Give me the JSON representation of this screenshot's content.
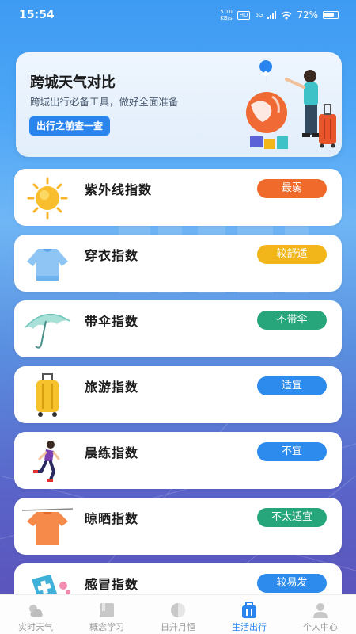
{
  "status": {
    "time": "15:54",
    "speed_value": "5.10",
    "speed_unit": "KB/s",
    "hd": "HD",
    "network": "5G",
    "battery": "72%"
  },
  "banner": {
    "title": "跨城天气对比",
    "subtitle": "跨城出行必备工具，做好全面准备",
    "button": "出行之前查一查"
  },
  "indices": [
    {
      "label": "紫外线指数",
      "badge": "最弱",
      "badge_color": "#f06a2c",
      "icon": "sun-icon"
    },
    {
      "label": "穿衣指数",
      "badge": "较舒适",
      "badge_color": "#f2b51a",
      "icon": "sweater-icon"
    },
    {
      "label": "带伞指数",
      "badge": "不带伞",
      "badge_color": "#27a67b",
      "icon": "umbrella-icon"
    },
    {
      "label": "旅游指数",
      "badge": "适宜",
      "badge_color": "#2d8bed",
      "icon": "luggage-icon"
    },
    {
      "label": "晨练指数",
      "badge": "不宜",
      "badge_color": "#2d8bed",
      "icon": "runner-icon"
    },
    {
      "label": "晾晒指数",
      "badge": "不太适宜",
      "badge_color": "#27a67b",
      "icon": "tshirt-icon"
    },
    {
      "label": "感冒指数",
      "badge": "较易发",
      "badge_color": "#2d8bed",
      "icon": "medical-icon"
    }
  ],
  "tabs": [
    {
      "label": "实时天气",
      "icon": "weather-icon",
      "active": false
    },
    {
      "label": "概念学习",
      "icon": "book-icon",
      "active": false
    },
    {
      "label": "日升月恒",
      "icon": "moon-icon",
      "active": false
    },
    {
      "label": "生活出行",
      "icon": "briefcase-icon",
      "active": true
    },
    {
      "label": "个人中心",
      "icon": "person-icon",
      "active": false
    }
  ],
  "colors": {
    "accent": "#2a84ee",
    "inactive_tab": "#9a9a9a"
  }
}
